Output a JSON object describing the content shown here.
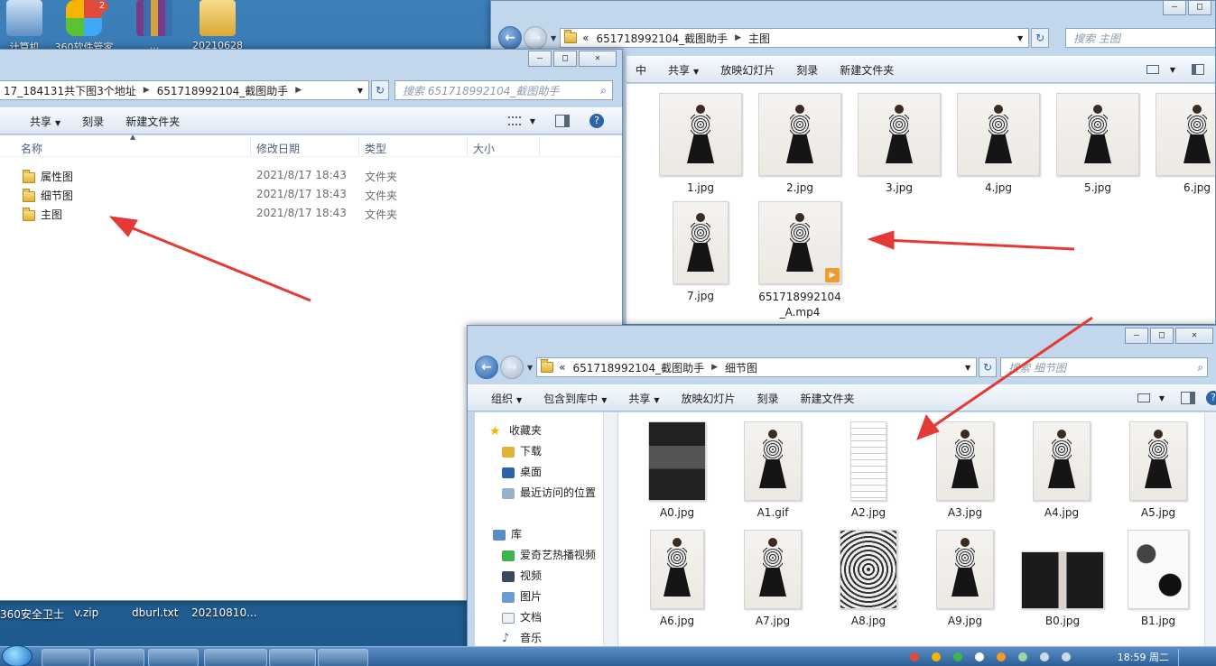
{
  "desktop": {
    "icons": [
      {
        "label": "计算机",
        "color": "#8fb0d6"
      },
      {
        "label": "360软件管家",
        "badge": "2",
        "color": "#e24a3b"
      },
      {
        "label": "...",
        "color": "#7a3a8a"
      },
      {
        "label": "20210628",
        "color": "#e7c05a"
      }
    ],
    "bottom_files": [
      "360安全卫士",
      "v.zip",
      "dburl.txt",
      "20210810..."
    ]
  },
  "window_left": {
    "address": {
      "crumbs": [
        "17_184131共下图3个地址",
        "651718992104_截图助手"
      ]
    },
    "search_placeholder": "搜索 651718992104_截图助手",
    "toolbar": [
      "共享",
      "刻录",
      "新建文件夹"
    ],
    "columns": [
      "名称",
      "修改日期",
      "类型",
      "大小"
    ],
    "rows": [
      {
        "name": "属性图",
        "date": "2021/8/17 18:43",
        "type": "文件夹"
      },
      {
        "name": "细节图",
        "date": "2021/8/17 18:43",
        "type": "文件夹"
      },
      {
        "name": "主图",
        "date": "2021/8/17 18:43",
        "type": "文件夹"
      }
    ],
    "caption_buttons": {
      "min": "—",
      "max": "□",
      "close": "✕"
    }
  },
  "window_top_right": {
    "address": {
      "prefix": "«",
      "crumbs": [
        "651718992104_截图助手",
        "主图"
      ]
    },
    "search_placeholder": "搜索 主图",
    "toolbar": [
      "中",
      "共享",
      "放映幻灯片",
      "刻录",
      "新建文件夹"
    ],
    "files": [
      "1.jpg",
      "2.jpg",
      "3.jpg",
      "4.jpg",
      "5.jpg",
      "6.jpg",
      "7.jpg",
      "651718992104_A.mp4"
    ],
    "caption_buttons": {
      "min": "—",
      "max": "□"
    }
  },
  "window_bottom_right": {
    "address": {
      "prefix": "«",
      "crumbs": [
        "651718992104_截图助手",
        "细节图"
      ]
    },
    "search_placeholder": "搜索 细节图",
    "toolbar": [
      "组织",
      "包含到库中",
      "共享",
      "放映幻灯片",
      "刻录",
      "新建文件夹"
    ],
    "nav": [
      {
        "label": "收藏夹",
        "icon": "star",
        "indent": false
      },
      {
        "label": "下载",
        "icon": "download",
        "indent": true
      },
      {
        "label": "桌面",
        "icon": "desktop",
        "indent": true
      },
      {
        "label": "最近访问的位置",
        "icon": "recent",
        "indent": true
      },
      {
        "label": "库",
        "icon": "library",
        "indent": false
      },
      {
        "label": "爱奇艺热播视频",
        "icon": "iqiyi",
        "indent": true
      },
      {
        "label": "视频",
        "icon": "video",
        "indent": true
      },
      {
        "label": "图片",
        "icon": "picture",
        "indent": true
      },
      {
        "label": "文档",
        "icon": "document",
        "indent": true
      },
      {
        "label": "音乐",
        "icon": "music",
        "indent": true
      }
    ],
    "files": [
      "A0.jpg",
      "A1.gif",
      "A2.jpg",
      "A3.jpg",
      "A4.jpg",
      "A5.jpg",
      "A6.jpg",
      "A7.jpg",
      "A8.jpg",
      "A9.jpg",
      "B0.jpg",
      "B1.jpg"
    ],
    "caption_buttons": {
      "min": "—",
      "max": "□",
      "close": "✕"
    }
  },
  "taskbar": {
    "clock": "18:59 周二"
  },
  "colors": {
    "arrow": "#e53935",
    "accent": "#2d63a8"
  }
}
